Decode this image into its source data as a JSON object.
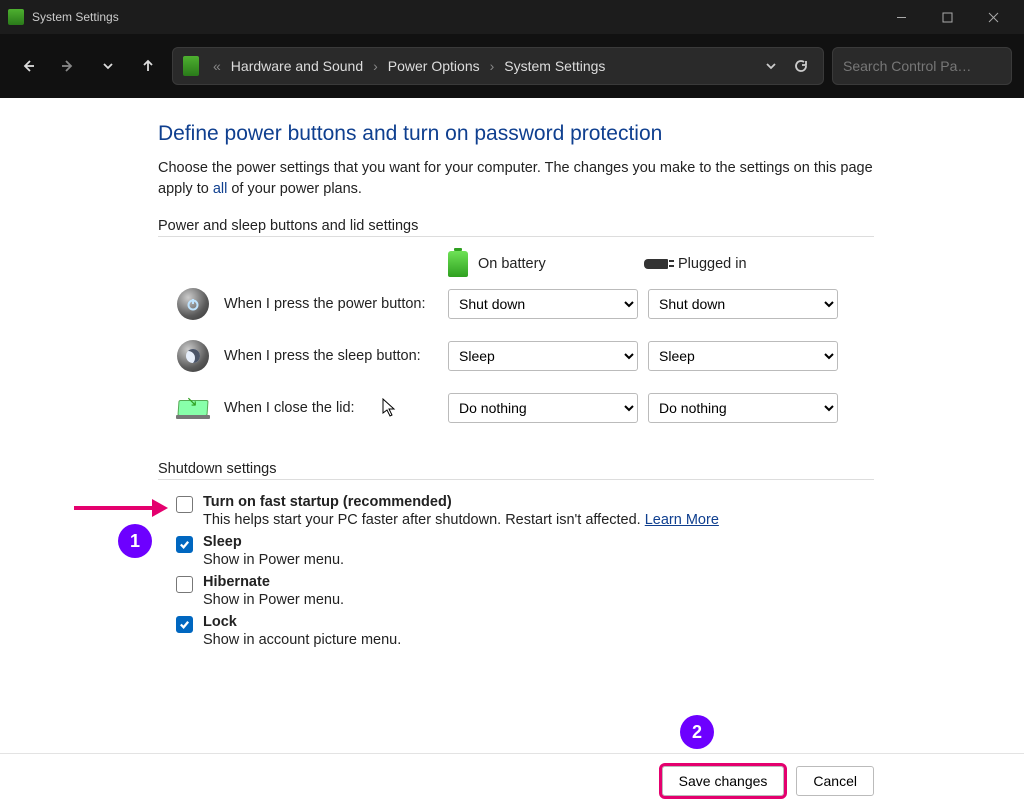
{
  "window": {
    "title": "System Settings"
  },
  "toolbar": {
    "search_placeholder": "Search Control Pa…",
    "breadcrumb_prefix": "«",
    "breadcrumbs": [
      "Hardware and Sound",
      "Power Options",
      "System Settings"
    ]
  },
  "page": {
    "heading": "Define power buttons and turn on password protection",
    "intro_pre": "Choose the power settings that you want for your computer. The changes you make to the settings on this page apply to ",
    "intro_all": "all",
    "intro_post": " of your power plans.",
    "section_power_header": "Power and sleep buttons and lid settings",
    "col_battery": "On battery",
    "col_plugged": "Plugged in",
    "rows": [
      {
        "label": "When I press the power button:",
        "battery": "Shut down",
        "plugged": "Shut down"
      },
      {
        "label": "When I press the sleep button:",
        "battery": "Sleep",
        "plugged": "Sleep"
      },
      {
        "label": "When I close the lid:",
        "battery": "Do nothing",
        "plugged": "Do nothing"
      }
    ],
    "section_shutdown_header": "Shutdown settings",
    "shutdown": [
      {
        "title": "Turn on fast startup (recommended)",
        "desc": "This helps start your PC faster after shutdown. Restart isn't affected. ",
        "link": "Learn More",
        "checked": false
      },
      {
        "title": "Sleep",
        "desc": "Show in Power menu.",
        "checked": true
      },
      {
        "title": "Hibernate",
        "desc": "Show in Power menu.",
        "checked": false
      },
      {
        "title": "Lock",
        "desc": "Show in account picture menu.",
        "checked": true
      }
    ]
  },
  "footer": {
    "save": "Save changes",
    "cancel": "Cancel"
  },
  "annotations": {
    "badge1": "1",
    "badge2": "2"
  }
}
